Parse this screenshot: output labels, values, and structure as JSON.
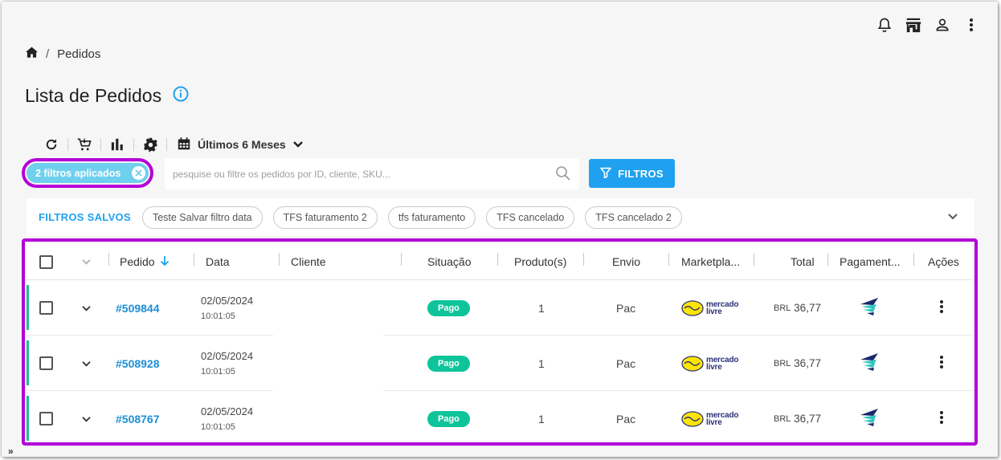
{
  "header": {
    "icons": [
      "bell-icon",
      "store-icon",
      "user-icon",
      "more-vert-icon"
    ]
  },
  "breadcrumb": {
    "home_icon": "home-icon",
    "separator": "/",
    "current": "Pedidos"
  },
  "page": {
    "title": "Lista de Pedidos",
    "info_icon": "info-icon"
  },
  "toolbar": {
    "icons": [
      "refresh-icon",
      "cart-icon",
      "bar-chart-icon",
      "gear-icon"
    ],
    "period_label": "Últimos 6 Meses"
  },
  "filters": {
    "chip_label": "2 filtros aplicados",
    "search_placeholder": "pesquise ou filtre os pedidos por ID, cliente, SKU...",
    "button_label": "FILTROS"
  },
  "saved_filters": {
    "label": "FILTROS SALVOS",
    "items": [
      "Teste Salvar filtro data",
      "TFS faturamento 2",
      "tfs faturamento",
      "TFS cancelado",
      "TFS cancelado 2"
    ]
  },
  "table": {
    "columns": {
      "pedido": "Pedido",
      "data": "Data",
      "cliente": "Cliente",
      "situacao": "Situação",
      "produtos": "Produto(s)",
      "envio": "Envio",
      "marketplace": "Marketpla...",
      "total": "Total",
      "pagamento": "Pagament...",
      "acoes": "Ações"
    },
    "rows": [
      {
        "id": "#509844",
        "date": "02/05/2024",
        "time": "10:01:05",
        "status": "Pago",
        "products": "1",
        "shipping": "Pac",
        "marketplace_l1": "mercado",
        "marketplace_l2": "livre",
        "currency": "BRL",
        "total": "36,77"
      },
      {
        "id": "#508928",
        "date": "02/05/2024",
        "time": "10:01:05",
        "status": "Pago",
        "products": "1",
        "shipping": "Pac",
        "marketplace_l1": "mercado",
        "marketplace_l2": "livre",
        "currency": "BRL",
        "total": "36,77"
      },
      {
        "id": "#508767",
        "date": "02/05/2024",
        "time": "10:01:05",
        "status": "Pago",
        "products": "1",
        "shipping": "Pac",
        "marketplace_l1": "mercado",
        "marketplace_l2": "livre",
        "currency": "BRL",
        "total": "36,77"
      }
    ]
  },
  "colors": {
    "accent": "#1fa1ef",
    "highlight": "#b400d8",
    "status_paid": "#0ec49a",
    "chip": "#6fd0ee"
  },
  "footer": {
    "expander": "»"
  }
}
